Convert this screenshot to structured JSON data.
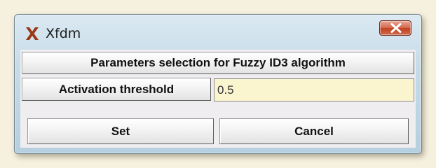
{
  "window": {
    "title": "Xfdm",
    "icon": "x-app-icon",
    "close_icon": "close-icon"
  },
  "dialog": {
    "header": "Parameters selection for Fuzzy ID3 algorithm",
    "fields": [
      {
        "label": "Activation threshold",
        "value": "0.5"
      }
    ],
    "buttons": {
      "set": "Set",
      "cancel": "Cancel"
    }
  },
  "colors": {
    "title_bar": "#c6dbe8",
    "close_button": "#c2401f",
    "app_icon": "#9a3818",
    "input_background": "#fbf5cf",
    "dialog_background": "#efedf0"
  }
}
